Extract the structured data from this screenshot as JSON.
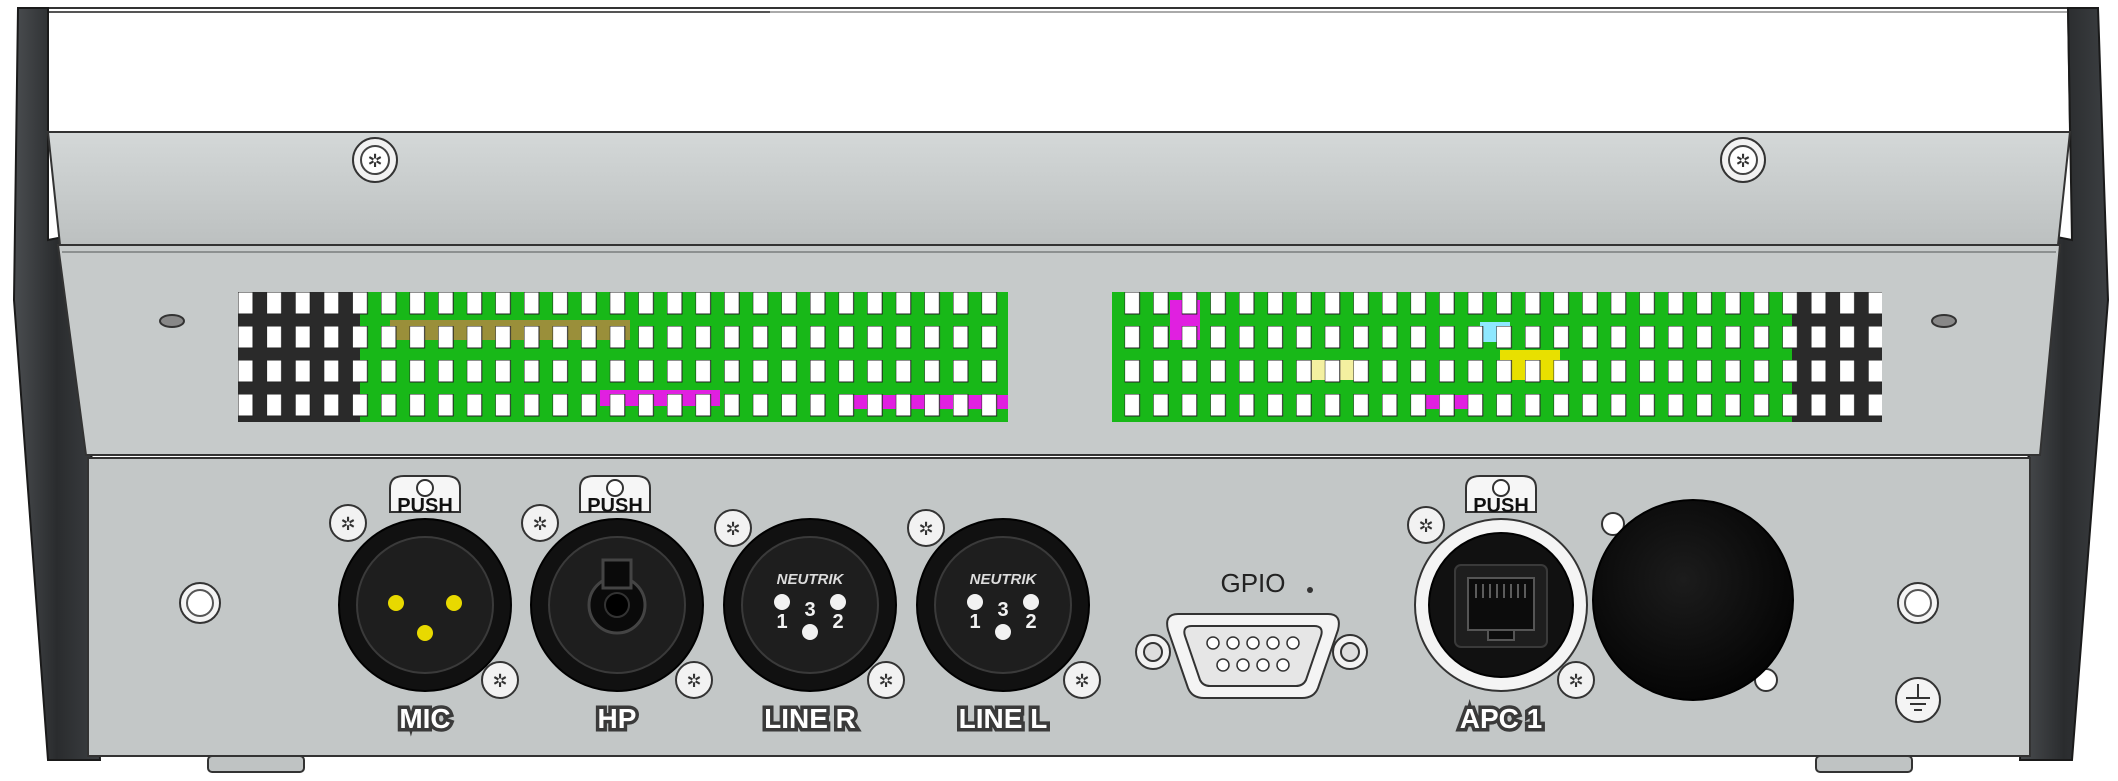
{
  "device": {
    "colors": {
      "chassis_top": "#c9cdcd",
      "panel": "#c3c7c7",
      "side": "#2e3133",
      "connector": "#111111",
      "pin_yellow": "#e8d900",
      "vent_green": "#18b818"
    }
  },
  "connectors": {
    "mic": {
      "label": "MIC",
      "tab": "PUSH"
    },
    "hp": {
      "label": "HP",
      "tab": "PUSH"
    },
    "line_r": {
      "label": "LINE R",
      "brand": "NEUTRIK",
      "pins": [
        "1",
        "3",
        "2"
      ]
    },
    "line_l": {
      "label": "LINE L",
      "brand": "NEUTRIK",
      "pins": [
        "1",
        "3",
        "2"
      ]
    },
    "gpio": {
      "label": "GPIO"
    },
    "apc1": {
      "label": "APC 1",
      "tab": "PUSH"
    }
  }
}
